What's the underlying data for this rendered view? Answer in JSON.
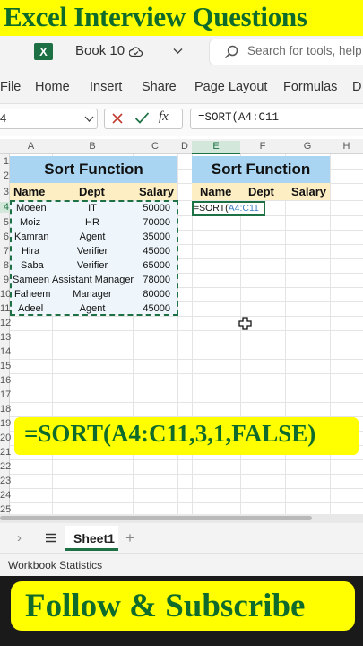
{
  "top_banner": {
    "text": "Excel Interview Questions"
  },
  "titlebar": {
    "app_logo": "X",
    "book_name": "Book 10",
    "search_placeholder": "Search for tools, help"
  },
  "menu": [
    "File",
    "Home",
    "Insert",
    "Share",
    "Page Layout",
    "Formulas",
    "D"
  ],
  "formula_bar": {
    "name_box": "4",
    "formula": "=SORT(A4:C11"
  },
  "columns": [
    "A",
    "B",
    "C",
    "D",
    "E",
    "F",
    "G",
    "H"
  ],
  "rows": [
    "1",
    "2",
    "3",
    "4",
    "5",
    "6",
    "7",
    "8",
    "9",
    "10",
    "11",
    "12",
    "13",
    "14",
    "15",
    "16",
    "17",
    "18",
    "19",
    "20",
    "21",
    "22",
    "23",
    "24",
    "25"
  ],
  "left_table": {
    "title": "Sort Function",
    "headers": [
      "Name",
      "Dept",
      "Salary"
    ],
    "rows": [
      [
        "Moeen",
        "IT",
        "50000"
      ],
      [
        "Moiz",
        "HR",
        "70000"
      ],
      [
        "Kamran",
        "Agent",
        "35000"
      ],
      [
        "Hira",
        "Verifier",
        "45000"
      ],
      [
        "Saba",
        "Verifier",
        "65000"
      ],
      [
        "Sameen",
        "Assistant Manager",
        "78000"
      ],
      [
        "Faheem",
        "Manager",
        "80000"
      ],
      [
        "Adeel",
        "Agent",
        "45000"
      ]
    ]
  },
  "right_table": {
    "title": "Sort Function",
    "headers": [
      "Name",
      "Dept",
      "Salary"
    ],
    "active_cell_prefix": "=SORT(",
    "active_cell_ref": "A4:C11"
  },
  "formula_banner": {
    "text": "=SORT(A4:C11,3,1,FALSE)"
  },
  "sheet_tabs": {
    "active": "Sheet1",
    "add": "+"
  },
  "status": {
    "text": "Workbook Statistics"
  },
  "bottom_banner": {
    "text": "Follow & Subscribe"
  },
  "colors": {
    "excel_green": "#1e7145",
    "banner_yellow": "#ffff00",
    "banner_text": "#0f6b2c",
    "title_blue": "#a9d5f2",
    "header_yellow": "#fdeec3"
  }
}
